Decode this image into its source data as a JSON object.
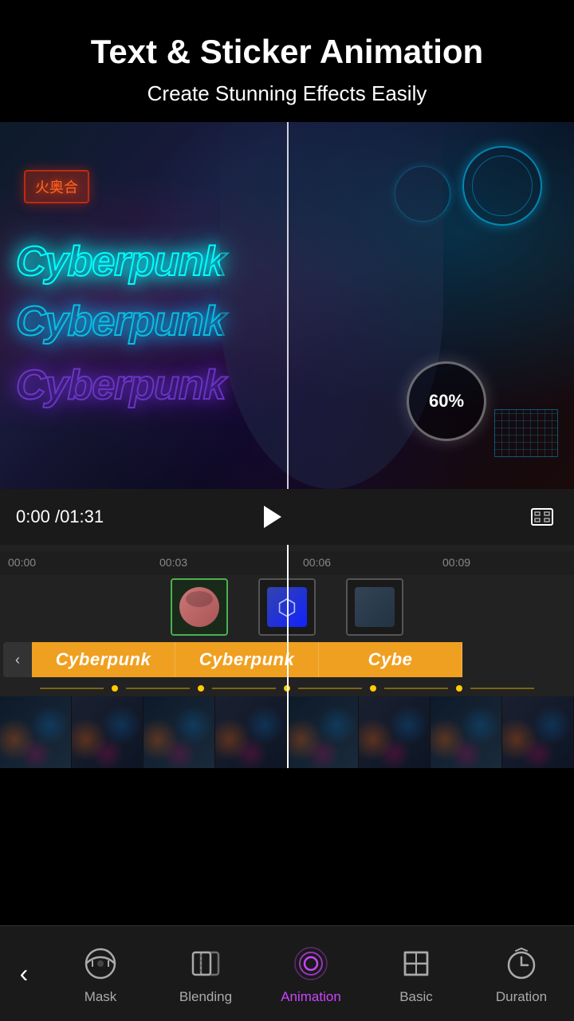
{
  "header": {
    "title": "Text & Sticker Animation",
    "subtitle": "Create Stunning Effects Easily"
  },
  "video": {
    "cyber_text_1": "Cyberpunk",
    "cyber_text_2": "Cyberpunk",
    "cyber_text_3": "Cyberpunk",
    "percent": "60%"
  },
  "controls": {
    "time_current": "0:00",
    "time_separator": " /",
    "time_total": "01:31",
    "play_label": "Play"
  },
  "ruler": {
    "marks": [
      "00:00",
      "00:03",
      "00:06",
      "00:09"
    ]
  },
  "text_track": {
    "back_label": "‹",
    "segments": [
      "Cyberpunk",
      "Cyberpunk",
      "Cybe"
    ]
  },
  "toolbar": {
    "items": [
      {
        "id": "back",
        "label": "",
        "icon": "back-icon"
      },
      {
        "id": "mask",
        "label": "Mask",
        "icon": "mask-icon"
      },
      {
        "id": "blending",
        "label": "Blending",
        "icon": "blending-icon"
      },
      {
        "id": "animation",
        "label": "Animation",
        "icon": "animation-icon",
        "active": true
      },
      {
        "id": "basic",
        "label": "Basic",
        "icon": "basic-icon"
      },
      {
        "id": "duration",
        "label": "Duration",
        "icon": "duration-icon"
      }
    ]
  },
  "colors": {
    "accent_purple": "#cc44ff",
    "accent_cyan": "#00ccff",
    "accent_orange": "#f0a020",
    "bg_dark": "#1a1a1a"
  }
}
